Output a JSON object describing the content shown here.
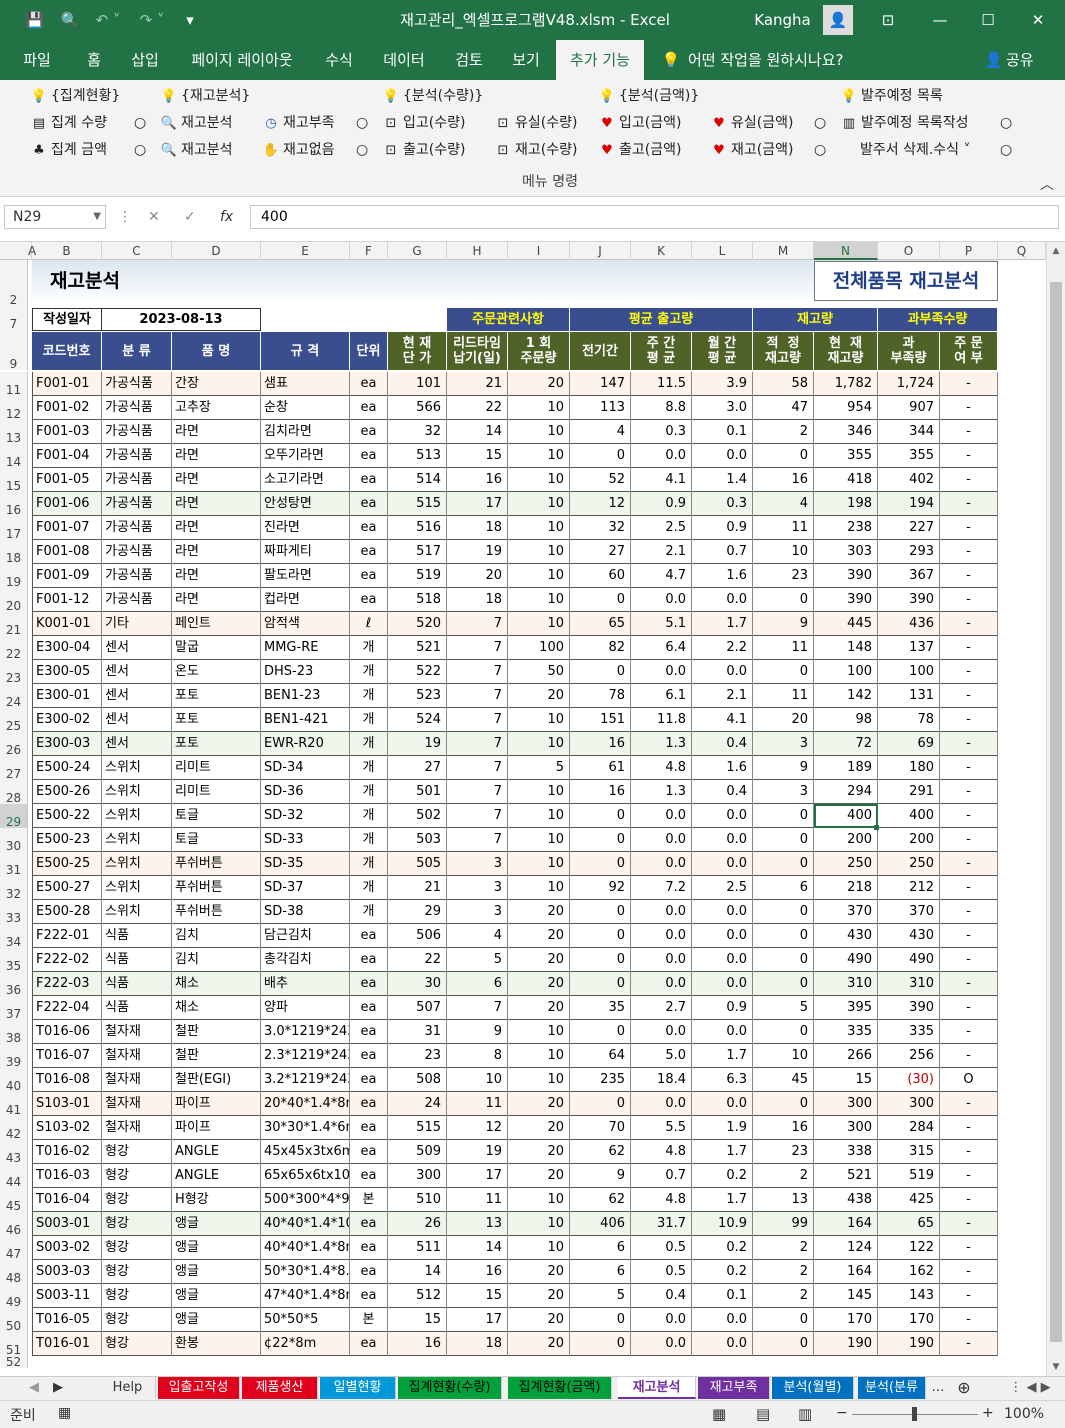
{
  "window": {
    "title": "재고관리_엑셀프로그램V48.xlsm  -  Excel",
    "user": "Kangha"
  },
  "menu": {
    "tabs": [
      "파일",
      "홈",
      "삽입",
      "페이지 레이아웃",
      "수식",
      "데이터",
      "검토",
      "보기",
      "추가 기능"
    ],
    "active": "추가 기능",
    "tell": "어떤 작업을 원하시나요?",
    "share": "공유"
  },
  "ribbon": {
    "row1": [
      "{집계현황}",
      "{재고분석}",
      "{분석(수량)}",
      "{분석(금액)}",
      "발주예정 목록"
    ],
    "row2": [
      "집계 수량",
      "재고분석",
      "재고부족",
      "입고(수량)",
      "유실(수량)",
      "입고(금액)",
      "유실(금액)",
      "발주예정 목록작성"
    ],
    "row3": [
      "집계 금액",
      "재고분석",
      "재고없음",
      "출고(수량)",
      "재고(수량)",
      "출고(금액)",
      "재고(금액)",
      "발주서 삭제.수식"
    ],
    "group_label": "메뉴 명령"
  },
  "formula": {
    "cell": "N29",
    "value": "400"
  },
  "columns": [
    "A",
    "B",
    "C",
    "D",
    "E",
    "F",
    "G",
    "H",
    "I",
    "J",
    "K",
    "L",
    "M",
    "N",
    "O",
    "P",
    "Q"
  ],
  "sheet": {
    "title": "재고분석",
    "subtitle": "전체품목 재고분석",
    "date_label": "작성일자",
    "date": "2023-08-13",
    "groups": [
      "주문관련사항",
      "평균 출고량",
      "재고량",
      "과부족수량"
    ],
    "headers": [
      "코드번호",
      "분 류",
      "품 명",
      "규 격",
      "단위",
      "현 재\n단 가",
      "리드타임\n납기(일)",
      "1 회\n주문량",
      "전기간",
      "주 간\n평 균",
      "월 간\n평 균",
      "적  정\n재고량",
      "현  재\n재고량",
      "과\n부족량",
      "주 문\n여 부"
    ],
    "rows": [
      [
        "11",
        "F001-01",
        "가공식품",
        "간장",
        "샘표",
        "ea",
        "101",
        "21",
        "20",
        "147",
        "11.5",
        "3.9",
        "58",
        "1,782",
        "1,724",
        "-"
      ],
      [
        "12",
        "F001-02",
        "가공식품",
        "고추장",
        "순창",
        "ea",
        "566",
        "22",
        "10",
        "113",
        "8.8",
        "3.0",
        "47",
        "954",
        "907",
        "-"
      ],
      [
        "13",
        "F001-03",
        "가공식품",
        "라면",
        "김치라면",
        "ea",
        "32",
        "14",
        "10",
        "4",
        "0.3",
        "0.1",
        "2",
        "346",
        "344",
        "-"
      ],
      [
        "14",
        "F001-04",
        "가공식품",
        "라면",
        "오뚜기라면",
        "ea",
        "513",
        "15",
        "10",
        "0",
        "0.0",
        "0.0",
        "0",
        "355",
        "355",
        "-"
      ],
      [
        "15",
        "F001-05",
        "가공식품",
        "라면",
        "소고기라면",
        "ea",
        "514",
        "16",
        "10",
        "52",
        "4.1",
        "1.4",
        "16",
        "418",
        "402",
        "-"
      ],
      [
        "16",
        "F001-06",
        "가공식품",
        "라면",
        "안성탕면",
        "ea",
        "515",
        "17",
        "10",
        "12",
        "0.9",
        "0.3",
        "4",
        "198",
        "194",
        "-"
      ],
      [
        "17",
        "F001-07",
        "가공식품",
        "라면",
        "진라면",
        "ea",
        "516",
        "18",
        "10",
        "32",
        "2.5",
        "0.9",
        "11",
        "238",
        "227",
        "-"
      ],
      [
        "18",
        "F001-08",
        "가공식품",
        "라면",
        "짜파게티",
        "ea",
        "517",
        "19",
        "10",
        "27",
        "2.1",
        "0.7",
        "10",
        "303",
        "293",
        "-"
      ],
      [
        "19",
        "F001-09",
        "가공식품",
        "라면",
        "팔도라면",
        "ea",
        "519",
        "20",
        "10",
        "60",
        "4.7",
        "1.6",
        "23",
        "390",
        "367",
        "-"
      ],
      [
        "20",
        "F001-12",
        "가공식품",
        "라면",
        "컵라면",
        "ea",
        "518",
        "18",
        "10",
        "0",
        "0.0",
        "0.0",
        "0",
        "390",
        "390",
        "-"
      ],
      [
        "21",
        "K001-01",
        "기타",
        "페인트",
        "암적색",
        "ℓ",
        "520",
        "7",
        "10",
        "65",
        "5.1",
        "1.7",
        "9",
        "445",
        "436",
        "-"
      ],
      [
        "22",
        "E300-04",
        "센서",
        "말굽",
        "MMG-RE",
        "개",
        "521",
        "7",
        "100",
        "82",
        "6.4",
        "2.2",
        "11",
        "148",
        "137",
        "-"
      ],
      [
        "23",
        "E300-05",
        "센서",
        "온도",
        "DHS-23",
        "개",
        "522",
        "7",
        "50",
        "0",
        "0.0",
        "0.0",
        "0",
        "100",
        "100",
        "-"
      ],
      [
        "24",
        "E300-01",
        "센서",
        "포토",
        "BEN1-23",
        "개",
        "523",
        "7",
        "20",
        "78",
        "6.1",
        "2.1",
        "11",
        "142",
        "131",
        "-"
      ],
      [
        "25",
        "E300-02",
        "센서",
        "포토",
        "BEN1-421",
        "개",
        "524",
        "7",
        "10",
        "151",
        "11.8",
        "4.1",
        "20",
        "98",
        "78",
        "-"
      ],
      [
        "26",
        "E300-03",
        "센서",
        "포토",
        "EWR-R20",
        "개",
        "19",
        "7",
        "10",
        "16",
        "1.3",
        "0.4",
        "3",
        "72",
        "69",
        "-"
      ],
      [
        "27",
        "E500-24",
        "스위치",
        "리미트",
        "SD-34",
        "개",
        "27",
        "7",
        "5",
        "61",
        "4.8",
        "1.6",
        "9",
        "189",
        "180",
        "-"
      ],
      [
        "28",
        "E500-26",
        "스위치",
        "리미트",
        "SD-36",
        "개",
        "501",
        "7",
        "10",
        "16",
        "1.3",
        "0.4",
        "3",
        "294",
        "291",
        "-"
      ],
      [
        "29",
        "E500-22",
        "스위치",
        "토글",
        "SD-32",
        "개",
        "502",
        "7",
        "10",
        "0",
        "0.0",
        "0.0",
        "0",
        "400",
        "400",
        "-"
      ],
      [
        "30",
        "E500-23",
        "스위치",
        "토글",
        "SD-33",
        "개",
        "503",
        "7",
        "10",
        "0",
        "0.0",
        "0.0",
        "0",
        "200",
        "200",
        "-"
      ],
      [
        "31",
        "E500-25",
        "스위치",
        "푸쉬버튼",
        "SD-35",
        "개",
        "505",
        "3",
        "10",
        "0",
        "0.0",
        "0.0",
        "0",
        "250",
        "250",
        "-"
      ],
      [
        "32",
        "E500-27",
        "스위치",
        "푸쉬버튼",
        "SD-37",
        "개",
        "21",
        "3",
        "10",
        "92",
        "7.2",
        "2.5",
        "6",
        "218",
        "212",
        "-"
      ],
      [
        "33",
        "E500-28",
        "스위치",
        "푸쉬버튼",
        "SD-38",
        "개",
        "29",
        "3",
        "20",
        "0",
        "0.0",
        "0.0",
        "0",
        "370",
        "370",
        "-"
      ],
      [
        "34",
        "F222-01",
        "식품",
        "김치",
        "담근김치",
        "ea",
        "506",
        "4",
        "20",
        "0",
        "0.0",
        "0.0",
        "0",
        "430",
        "430",
        "-"
      ],
      [
        "35",
        "F222-02",
        "식품",
        "김치",
        "총각김치",
        "ea",
        "22",
        "5",
        "20",
        "0",
        "0.0",
        "0.0",
        "0",
        "490",
        "490",
        "-"
      ],
      [
        "36",
        "F222-03",
        "식품",
        "채소",
        "배추",
        "ea",
        "30",
        "6",
        "20",
        "0",
        "0.0",
        "0.0",
        "0",
        "310",
        "310",
        "-"
      ],
      [
        "37",
        "F222-04",
        "식품",
        "채소",
        "양파",
        "ea",
        "507",
        "7",
        "20",
        "35",
        "2.7",
        "0.9",
        "5",
        "395",
        "390",
        "-"
      ],
      [
        "38",
        "T016-06",
        "철자재",
        "철판",
        "3.0*1219*2438",
        "ea",
        "31",
        "9",
        "10",
        "0",
        "0.0",
        "0.0",
        "0",
        "335",
        "335",
        "-"
      ],
      [
        "39",
        "T016-07",
        "철자재",
        "철판",
        "2.3*1219*2438",
        "ea",
        "23",
        "8",
        "10",
        "64",
        "5.0",
        "1.7",
        "10",
        "266",
        "256",
        "-"
      ],
      [
        "40",
        "T016-08",
        "철자재",
        "철판(EGI)",
        "3.2*1219*2438",
        "ea",
        "508",
        "10",
        "10",
        "235",
        "18.4",
        "6.3",
        "45",
        "15",
        "(30)",
        "O"
      ],
      [
        "41",
        "S103-01",
        "철자재",
        "파이프",
        "20*40*1.4*8m",
        "ea",
        "24",
        "11",
        "20",
        "0",
        "0.0",
        "0.0",
        "0",
        "300",
        "300",
        "-"
      ],
      [
        "42",
        "S103-02",
        "철자재",
        "파이프",
        "30*30*1.4*6m",
        "ea",
        "515",
        "12",
        "20",
        "70",
        "5.5",
        "1.9",
        "16",
        "300",
        "284",
        "-"
      ],
      [
        "43",
        "T016-02",
        "형강",
        "ANGLE",
        "45x45x3tx6m",
        "ea",
        "509",
        "19",
        "20",
        "62",
        "4.8",
        "1.7",
        "23",
        "338",
        "315",
        "-"
      ],
      [
        "44",
        "T016-03",
        "형강",
        "ANGLE",
        "65x65x6tx10m",
        "ea",
        "300",
        "17",
        "20",
        "9",
        "0.7",
        "0.2",
        "2",
        "521",
        "519",
        "-"
      ],
      [
        "45",
        "T016-04",
        "형강",
        "H형강",
        "500*300*4*9",
        "본",
        "510",
        "11",
        "10",
        "62",
        "4.8",
        "1.7",
        "13",
        "438",
        "425",
        "-"
      ],
      [
        "46",
        "S003-01",
        "형강",
        "앵글",
        "40*40*1.4*10m",
        "ea",
        "26",
        "13",
        "10",
        "406",
        "31.7",
        "10.9",
        "99",
        "164",
        "65",
        "-"
      ],
      [
        "47",
        "S003-02",
        "형강",
        "앵글",
        "40*40*1.4*8m",
        "ea",
        "511",
        "14",
        "10",
        "6",
        "0.5",
        "0.2",
        "2",
        "124",
        "122",
        "-"
      ],
      [
        "48",
        "S003-03",
        "형강",
        "앵글",
        "50*30*1.4*8.4m",
        "ea",
        "14",
        "16",
        "20",
        "6",
        "0.5",
        "0.2",
        "2",
        "164",
        "162",
        "-"
      ],
      [
        "49",
        "S003-11",
        "형강",
        "앵글",
        "47*40*1.4*8m",
        "ea",
        "512",
        "15",
        "20",
        "5",
        "0.4",
        "0.1",
        "2",
        "145",
        "143",
        "-"
      ],
      [
        "50",
        "T016-05",
        "형강",
        "앵글",
        "50*50*5",
        "본",
        "15",
        "17",
        "20",
        "0",
        "0.0",
        "0.0",
        "0",
        "170",
        "170",
        "-"
      ],
      [
        "51",
        "T016-01",
        "형강",
        "환봉",
        "¢22*8m",
        "ea",
        "16",
        "18",
        "20",
        "0",
        "0.0",
        "0.0",
        "0",
        "190",
        "190",
        "-"
      ]
    ]
  },
  "sheet_tabs": [
    {
      "label": "Help",
      "color": "#f0f0f0",
      "fg": "#333"
    },
    {
      "label": "입출고작성",
      "color": "#e0001b",
      "fg": "#ffffff"
    },
    {
      "label": "제품생산",
      "color": "#e0001b",
      "fg": "#ffffff"
    },
    {
      "label": "일별현황",
      "color": "#0098d8",
      "fg": "#ffffff"
    },
    {
      "label": "집계현황(수량)",
      "color": "#00a03c",
      "fg": "#000000"
    },
    {
      "label": "집계현황(금액)",
      "color": "#00a03c",
      "fg": "#000000"
    },
    {
      "label": "재고분석",
      "color": "#ffffff",
      "fg": "#7030a0"
    },
    {
      "label": "재고부족",
      "color": "#7030a0",
      "fg": "#ffffff"
    },
    {
      "label": "분석(월별)",
      "color": "#0070c0",
      "fg": "#ffffff"
    },
    {
      "label": "분석(분류",
      "color": "#0070c0",
      "fg": "#ffffff"
    }
  ],
  "status": {
    "ready": "준비",
    "zoom": "100%"
  },
  "colors": {
    "excel_green": "#217346",
    "header_green": "#4f6228",
    "header_yellow": "#ffff00",
    "group_blue": "#3a4d8f"
  }
}
